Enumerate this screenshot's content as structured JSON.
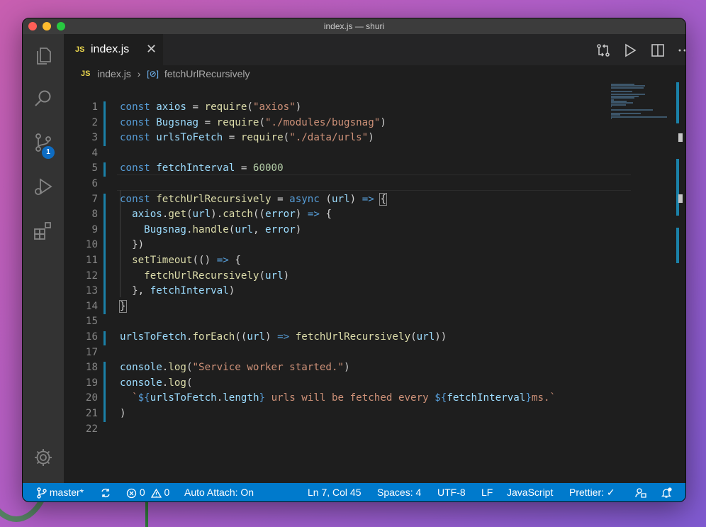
{
  "window": {
    "title": "index.js — shuri"
  },
  "activity_bar": {
    "source_control_badge": "1"
  },
  "tab": {
    "icon_label": "JS",
    "name": "index.js",
    "close_glyph": "✕"
  },
  "breadcrumbs": {
    "icon_label": "JS",
    "file": "index.js",
    "separator": "›",
    "symbol_glyph": "[⊘]",
    "symbol": "fetchUrlRecursively"
  },
  "editor": {
    "line_numbers": [
      "1",
      "2",
      "3",
      "4",
      "5",
      "6",
      "7",
      "8",
      "9",
      "10",
      "11",
      "12",
      "13",
      "14",
      "15",
      "16",
      "17",
      "18",
      "19",
      "20",
      "21",
      "22"
    ],
    "lines": [
      [
        {
          "t": "const ",
          "c": "kw"
        },
        {
          "t": "axios",
          "c": "var"
        },
        {
          "t": " = ",
          "c": ""
        },
        {
          "t": "require",
          "c": "fn"
        },
        {
          "t": "(",
          "c": ""
        },
        {
          "t": "\"axios\"",
          "c": "str"
        },
        {
          "t": ")",
          "c": ""
        }
      ],
      [
        {
          "t": "const ",
          "c": "kw"
        },
        {
          "t": "Bugsnag",
          "c": "var"
        },
        {
          "t": " = ",
          "c": ""
        },
        {
          "t": "require",
          "c": "fn"
        },
        {
          "t": "(",
          "c": ""
        },
        {
          "t": "\"./modules/bugsnag\"",
          "c": "str"
        },
        {
          "t": ")",
          "c": ""
        }
      ],
      [
        {
          "t": "const ",
          "c": "kw"
        },
        {
          "t": "urlsToFetch",
          "c": "var"
        },
        {
          "t": " = ",
          "c": ""
        },
        {
          "t": "require",
          "c": "fn"
        },
        {
          "t": "(",
          "c": ""
        },
        {
          "t": "\"./data/urls\"",
          "c": "str"
        },
        {
          "t": ")",
          "c": ""
        }
      ],
      [],
      [
        {
          "t": "const ",
          "c": "kw"
        },
        {
          "t": "fetchInterval",
          "c": "var"
        },
        {
          "t": " = ",
          "c": ""
        },
        {
          "t": "60000",
          "c": "num"
        }
      ],
      [],
      [
        {
          "t": "const ",
          "c": "kw"
        },
        {
          "t": "fetchUrlRecursively",
          "c": "fn"
        },
        {
          "t": " = ",
          "c": ""
        },
        {
          "t": "async",
          "c": "kw"
        },
        {
          "t": " (",
          "c": ""
        },
        {
          "t": "url",
          "c": "var"
        },
        {
          "t": ") ",
          "c": ""
        },
        {
          "t": "=>",
          "c": "kw"
        },
        {
          "t": " ",
          "c": ""
        },
        {
          "t": "{",
          "c": "box"
        }
      ],
      [
        {
          "t": "  ",
          "c": ""
        },
        {
          "t": "axios",
          "c": "var"
        },
        {
          "t": ".",
          "c": ""
        },
        {
          "t": "get",
          "c": "fn"
        },
        {
          "t": "(",
          "c": ""
        },
        {
          "t": "url",
          "c": "var"
        },
        {
          "t": ").",
          "c": ""
        },
        {
          "t": "catch",
          "c": "fn"
        },
        {
          "t": "((",
          "c": ""
        },
        {
          "t": "error",
          "c": "var"
        },
        {
          "t": ") ",
          "c": ""
        },
        {
          "t": "=>",
          "c": "kw"
        },
        {
          "t": " {",
          "c": ""
        }
      ],
      [
        {
          "t": "    ",
          "c": ""
        },
        {
          "t": "Bugsnag",
          "c": "var"
        },
        {
          "t": ".",
          "c": ""
        },
        {
          "t": "handle",
          "c": "fn"
        },
        {
          "t": "(",
          "c": ""
        },
        {
          "t": "url",
          "c": "var"
        },
        {
          "t": ", ",
          "c": ""
        },
        {
          "t": "error",
          "c": "var"
        },
        {
          "t": ")",
          "c": ""
        }
      ],
      [
        {
          "t": "  })",
          "c": ""
        }
      ],
      [
        {
          "t": "  ",
          "c": ""
        },
        {
          "t": "setTimeout",
          "c": "fn"
        },
        {
          "t": "(() ",
          "c": ""
        },
        {
          "t": "=>",
          "c": "kw"
        },
        {
          "t": " {",
          "c": ""
        }
      ],
      [
        {
          "t": "    ",
          "c": ""
        },
        {
          "t": "fetchUrlRecursively",
          "c": "fn"
        },
        {
          "t": "(",
          "c": ""
        },
        {
          "t": "url",
          "c": "var"
        },
        {
          "t": ")",
          "c": ""
        }
      ],
      [
        {
          "t": "  }, ",
          "c": ""
        },
        {
          "t": "fetchInterval",
          "c": "var"
        },
        {
          "t": ")",
          "c": ""
        }
      ],
      [
        {
          "t": "}",
          "c": "box"
        }
      ],
      [],
      [
        {
          "t": "urlsToFetch",
          "c": "var"
        },
        {
          "t": ".",
          "c": ""
        },
        {
          "t": "forEach",
          "c": "fn"
        },
        {
          "t": "((",
          "c": ""
        },
        {
          "t": "url",
          "c": "var"
        },
        {
          "t": ") ",
          "c": ""
        },
        {
          "t": "=>",
          "c": "kw"
        },
        {
          "t": " ",
          "c": ""
        },
        {
          "t": "fetchUrlRecursively",
          "c": "fn"
        },
        {
          "t": "(",
          "c": ""
        },
        {
          "t": "url",
          "c": "var"
        },
        {
          "t": "))",
          "c": ""
        }
      ],
      [],
      [
        {
          "t": "console",
          "c": "var"
        },
        {
          "t": ".",
          "c": ""
        },
        {
          "t": "log",
          "c": "fn"
        },
        {
          "t": "(",
          "c": ""
        },
        {
          "t": "\"Service worker started.\"",
          "c": "str"
        },
        {
          "t": ")",
          "c": ""
        }
      ],
      [
        {
          "t": "console",
          "c": "var"
        },
        {
          "t": ".",
          "c": ""
        },
        {
          "t": "log",
          "c": "fn"
        },
        {
          "t": "(",
          "c": ""
        }
      ],
      [
        {
          "t": "  ",
          "c": ""
        },
        {
          "t": "`",
          "c": "str"
        },
        {
          "t": "${",
          "c": "tpl"
        },
        {
          "t": "urlsToFetch",
          "c": "var"
        },
        {
          "t": ".",
          "c": ""
        },
        {
          "t": "length",
          "c": "var"
        },
        {
          "t": "}",
          "c": "tpl"
        },
        {
          "t": " urls will be fetched every ",
          "c": "str"
        },
        {
          "t": "${",
          "c": "tpl"
        },
        {
          "t": "fetchInterval",
          "c": "var"
        },
        {
          "t": "}",
          "c": "tpl"
        },
        {
          "t": "ms.`",
          "c": "str"
        }
      ],
      [
        {
          "t": ")",
          "c": ""
        }
      ],
      []
    ]
  },
  "status_bar": {
    "branch": "master*",
    "errors": "0",
    "warnings": "0",
    "auto_attach": "Auto Attach: On",
    "cursor": "Ln 7, Col 45",
    "spaces": "Spaces: 4",
    "encoding": "UTF-8",
    "eol": "LF",
    "language": "JavaScript",
    "formatter": "Prettier: ✓"
  },
  "colors": {
    "status_bar": "#007acc",
    "editor_bg": "#1e1e1e",
    "activity_bar": "#333333"
  }
}
